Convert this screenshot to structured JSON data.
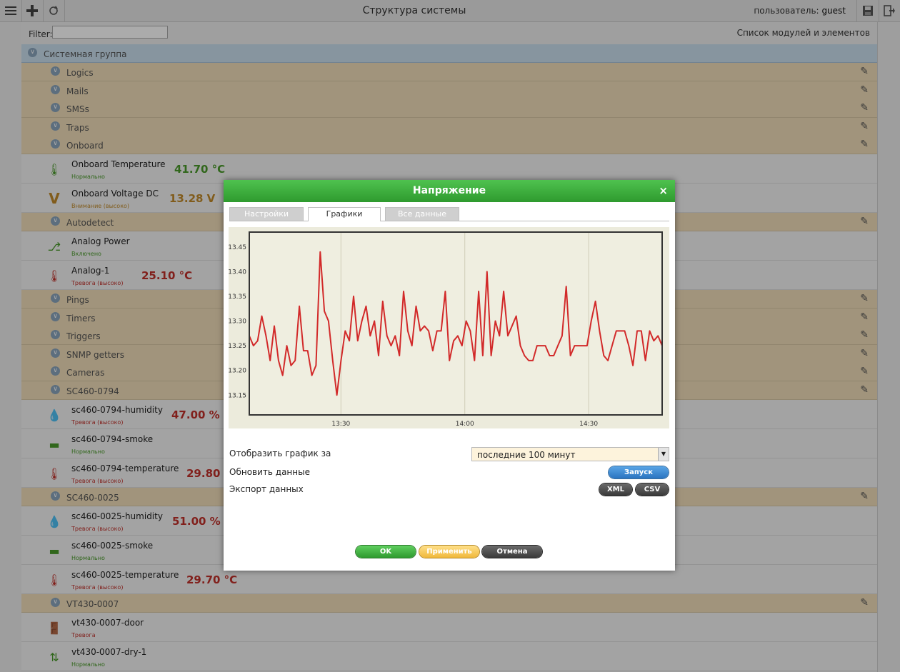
{
  "topbar": {
    "title": "Структура системы",
    "user_label": "пользователь:",
    "user_name": "guest"
  },
  "filter": {
    "label": "Filter:",
    "value": "",
    "right_label": "Список модулей и элементов"
  },
  "system_group": "Системная группа",
  "groups": {
    "logics": "Logics",
    "mails": "Mails",
    "smss": "SMSs",
    "traps": "Traps",
    "onboard": "Onboard",
    "autodetect": "Autodetect",
    "pings": "Pings",
    "timers": "Timers",
    "triggers": "Triggers",
    "snmp": "SNMP getters",
    "cameras": "Cameras",
    "sc460_0794": "SC460-0794",
    "sc460_0025": "SC460-0025",
    "vt430": "VT430-0007"
  },
  "items": {
    "onboard_temp": {
      "name": "Onboard Temperature",
      "status": "Нормально",
      "value": "41.70 °C"
    },
    "onboard_volt": {
      "name": "Onboard Voltage DC",
      "status": "Внимание (высоко)",
      "value": "13.28 V"
    },
    "analog_power": {
      "name": "Analog Power",
      "status": "Включено",
      "value": ""
    },
    "analog1": {
      "name": "Analog-1",
      "status": "Тревога (высоко)",
      "value": "25.10 °C"
    },
    "h0794": {
      "name": "sc460-0794-humidity",
      "status": "Тревога (высоко)",
      "value": "47.00 %"
    },
    "s0794": {
      "name": "sc460-0794-smoke",
      "status": "Нормально",
      "value": ""
    },
    "t0794": {
      "name": "sc460-0794-temperature",
      "status": "Тревога (высоко)",
      "value": "29.80 °C"
    },
    "h0025": {
      "name": "sc460-0025-humidity",
      "status": "Тревога (высоко)",
      "value": "51.00 %"
    },
    "s0025": {
      "name": "sc460-0025-smoke",
      "status": "Нормально",
      "value": ""
    },
    "t0025": {
      "name": "sc460-0025-temperature",
      "status": "Тревога (высоко)",
      "value": "29.70 °C"
    },
    "door": {
      "name": "vt430-0007-door",
      "status": "Тревога",
      "value": ""
    },
    "dry1": {
      "name": "vt430-0007-dry-1",
      "status": "Нормально",
      "value": ""
    }
  },
  "dialog": {
    "title": "Напряжение",
    "close": "×",
    "tabs": {
      "settings": "Настройки",
      "graphs": "Графики",
      "all_data": "Все данные"
    },
    "period_label": "Отобразить график за",
    "period_value": "последние 100 минут",
    "refresh_label": "Обновить данные",
    "refresh_button": "Запуск",
    "export_label": "Экспорт данных",
    "xml_button": "XML",
    "csv_button": "CSV",
    "ok_button": "OK",
    "apply_button": "Применить",
    "cancel_button": "Отмена"
  },
  "colors": {
    "line": "#d22a2a",
    "header_green": "#3aaa3a",
    "group_bg": "#f0ddb9",
    "alarm": "#c0302a",
    "normal": "#4a9a2a",
    "warn": "#c08a2a"
  },
  "chart_data": {
    "type": "line",
    "x_ticks": [
      "13:30",
      "14:00",
      "14:30"
    ],
    "y_ticks": [
      13.15,
      13.2,
      13.25,
      13.3,
      13.35,
      13.4,
      13.45
    ],
    "ylim": [
      13.11,
      13.48
    ],
    "grid": true,
    "series": [
      {
        "values": [
          13.27,
          13.25,
          13.26,
          13.31,
          13.27,
          13.22,
          13.29,
          13.22,
          13.19,
          13.25,
          13.21,
          13.22,
          13.33,
          13.24,
          13.24,
          13.19,
          13.21,
          13.44,
          13.32,
          13.3,
          13.22,
          13.15,
          13.22,
          13.28,
          13.26,
          13.35,
          13.26,
          13.3,
          13.33,
          13.27,
          13.3,
          13.23,
          13.34,
          13.27,
          13.25,
          13.27,
          13.23,
          13.36,
          13.28,
          13.25,
          13.33,
          13.28,
          13.29,
          13.28,
          13.24,
          13.28,
          13.28,
          13.36,
          13.22,
          13.26,
          13.27,
          13.25,
          13.3,
          13.28,
          13.22,
          13.36,
          13.23,
          13.4,
          13.23,
          13.3,
          13.27,
          13.36,
          13.27,
          13.29,
          13.31,
          13.25,
          13.23,
          13.22,
          13.22,
          13.25,
          13.25,
          13.25,
          13.23,
          13.23,
          13.25,
          13.27,
          13.37,
          13.23,
          13.25,
          13.25,
          13.25,
          13.25,
          13.3,
          13.34,
          13.28,
          13.23,
          13.22,
          13.25,
          13.28,
          13.28,
          13.28,
          13.25,
          13.21,
          13.28,
          13.28,
          13.22,
          13.28,
          13.26,
          13.27,
          13.25
        ]
      }
    ]
  }
}
